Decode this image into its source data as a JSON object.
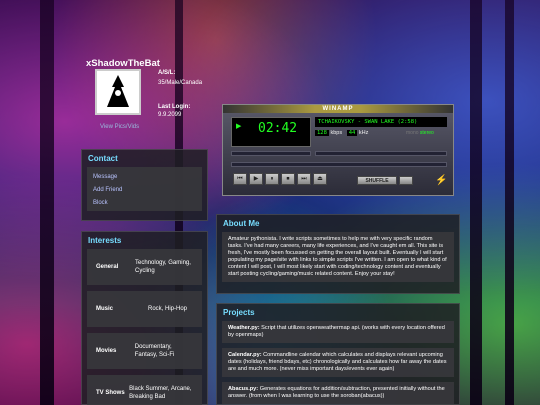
{
  "profile": {
    "username": "xShadowTheBat",
    "view_pics": "View Pics/Vids",
    "asl_label": "A/S/L:",
    "asl_value": "35/Male/Canada",
    "login_label": "Last Login:",
    "login_value": "9.9.2099"
  },
  "contact": {
    "title": "Contact",
    "links": [
      "Message",
      "Add Friend",
      "Block"
    ]
  },
  "interests": {
    "title": "Interests",
    "rows": [
      {
        "key": "General",
        "value": "Technology, Gaming, Cycling"
      },
      {
        "key": "Music",
        "value": "Rock, Hip-Hop"
      },
      {
        "key": "Movies",
        "value": "Documentary, Fantasy, Sci-Fi"
      },
      {
        "key": "TV Shows",
        "value": "Black Summer, Arcane, Breaking Bad"
      }
    ]
  },
  "about": {
    "title": "About Me",
    "text": "Amateur pythonista. I write scripts sometimes to help me with very specific random tasks. I've had many careers, many life experiences, and I've caught em all. This site is fresh, I've mostly been focussed on getting the overall layout built. Eventually I will start populating my page/site with links to simple scripts I've written. I am open to what kind of content I will post, I will most likely start with coding/technology content and eventually start posting cycling/gaming/music related content. Enjoy your stay!"
  },
  "projects": {
    "title": "Projects",
    "items": [
      {
        "name": "Weather.py:",
        "desc": "Script that utilizes openweathermap api. (works with every location offered by openmaps)"
      },
      {
        "name": "Calendar.py:",
        "desc": "Commandline calendar which calculates and displays relevant upcoming dates (holidays, friend bdays, etc) chronologically and calculates how far away the dates are and much more. (never miss important days/events ever again)"
      },
      {
        "name": "Abacus.py:",
        "desc": "Generates equations for addition/subtraction, presented initially without the answer. (from when I was learning to use the soroban(abacus))"
      }
    ]
  },
  "winamp": {
    "title": "WINAMP",
    "time": "02:42",
    "track": "TCHAIKOVSKY - SWAN LAKE (2:58)",
    "kbps_value": "128",
    "kbps_label": "kbps",
    "khz_value": "44",
    "khz_label": "kHz",
    "mono": "mono",
    "stereo": "stereo",
    "shuffle": "SHUFFLE",
    "buttons": [
      "⏮",
      "▶",
      "⏸",
      "⏹",
      "⏭",
      "⏏"
    ]
  }
}
